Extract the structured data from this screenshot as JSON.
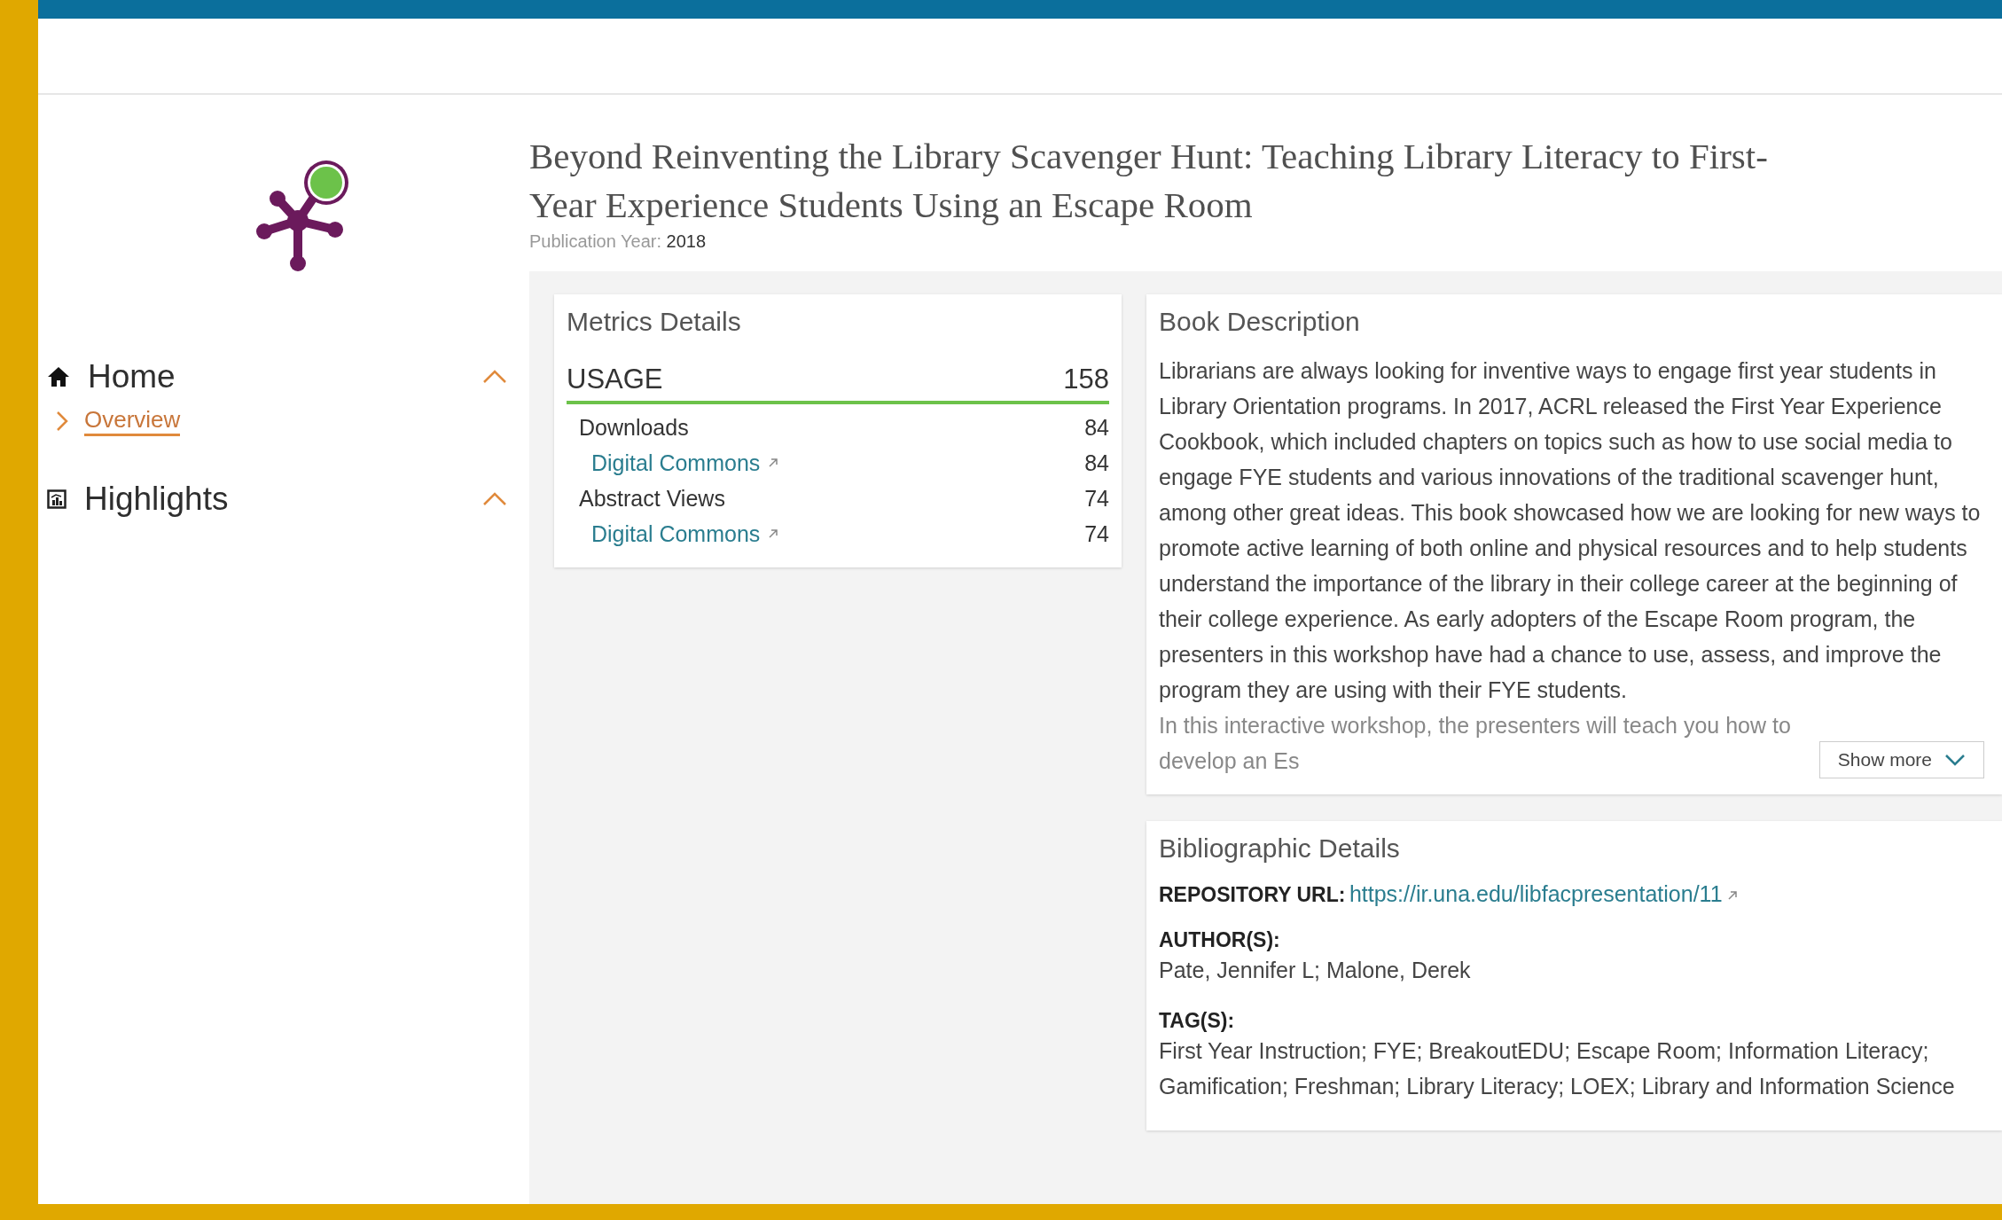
{
  "sidebar": {
    "items": [
      {
        "label": "Home",
        "expanded": true,
        "children": [
          {
            "label": "Overview",
            "selected": true
          }
        ]
      },
      {
        "label": "Highlights",
        "expanded": true
      }
    ]
  },
  "publication": {
    "title": "Beyond Reinventing the Library Scavenger Hunt: Teaching Library Literacy to First-Year Experience Students Using an Escape Room",
    "year_label": "Publication Year:",
    "year": "2018"
  },
  "metrics": {
    "title": "Metrics Details",
    "usage": {
      "label": "USAGE",
      "value": "158"
    },
    "rows": [
      {
        "kind": "category",
        "label": "Downloads",
        "value": "84"
      },
      {
        "kind": "source",
        "label": "Digital Commons",
        "value": "84"
      },
      {
        "kind": "category",
        "label": "Abstract Views",
        "value": "74"
      },
      {
        "kind": "source",
        "label": "Digital Commons",
        "value": "74"
      }
    ]
  },
  "description": {
    "title": "Book Description",
    "text": "Librarians are always looking for inventive ways to engage first year students in Library Orientation programs. In 2017, ACRL released the First Year Experience Cookbook, which included chapters on topics such as how to use social media to engage FYE students and various innovations of the traditional scavenger hunt, among other great ideas. This book showcased how we are looking for new ways to promote active learning of both online and physical resources and to help students understand the importance of the library in their college career at the beginning of their college experience. As early adopters of the Escape Room program, the presenters in this workshop have had a chance to use, assess, and improve the program they are using with their FYE students.",
    "faded_text": "In this interactive workshop, the presenters will teach you how to develop an Es",
    "show_more": "Show more"
  },
  "bibliographic": {
    "title": "Bibliographic Details",
    "fields": [
      {
        "kind": "link",
        "label": "REPOSITORY URL:",
        "value": "https://ir.una.edu/libfacpresentation/11"
      },
      {
        "kind": "block",
        "label": "AUTHOR(S):",
        "value": "Pate, Jennifer L; Malone, Derek"
      },
      {
        "kind": "block",
        "label": "TAG(S):",
        "value": "First Year Instruction; FYE; BreakoutEDU; Escape Room; Information Literacy; Gamification; Freshman; Library Literacy; LOEX; Library and Information Science"
      }
    ]
  }
}
